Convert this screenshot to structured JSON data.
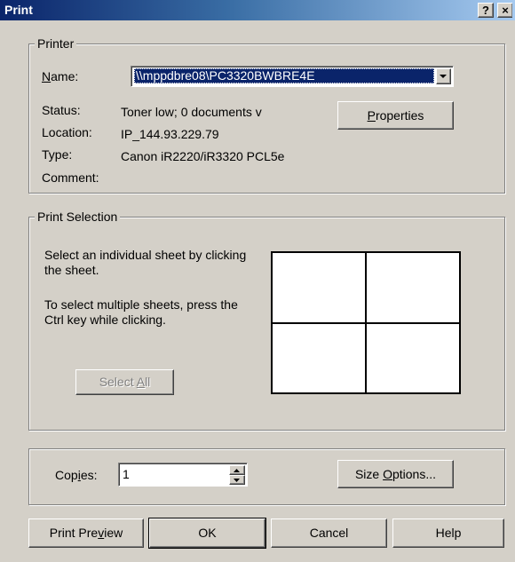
{
  "window": {
    "title": "Print",
    "help_glyph": "?",
    "close_glyph": "×"
  },
  "printer_group": {
    "label": "Printer",
    "name_label_prefix": "",
    "name_label_mnemonic": "N",
    "name_label_rest": "ame:",
    "name_value": "\\\\mppdbre08\\PC3320BWBRE4E",
    "status_label": "Status:",
    "status_value": "Toner low; 0 documents v",
    "location_label": "Location:",
    "location_value": "IP_144.93.229.79",
    "type_label": "Type:",
    "type_value": "Canon iR2220/iR3320 PCL5e",
    "comment_label": "Comment:",
    "comment_value": "",
    "properties_prefix": "",
    "properties_mnemonic": "P",
    "properties_rest": "roperties",
    "dropdown_icon": "triangle-down"
  },
  "selection_group": {
    "label": "Print Selection",
    "instruction_1": "Select an individual sheet by clicking the sheet.",
    "instruction_2": "To select multiple sheets, press the Ctrl key while clicking.",
    "select_all_prefix": "Select ",
    "select_all_mnemonic": "A",
    "select_all_rest": "ll",
    "sheets": [
      "",
      "",
      "",
      ""
    ]
  },
  "copies_group": {
    "copies_prefix": "Cop",
    "copies_mnemonic": "i",
    "copies_rest": "es:",
    "copies_value": "1",
    "size_options_prefix": "Size ",
    "size_options_mnemonic": "O",
    "size_options_rest": "ptions..."
  },
  "buttons": {
    "preview_prefix": "Print Pre",
    "preview_mnemonic": "v",
    "preview_rest": "iew",
    "ok": "OK",
    "cancel": "Cancel",
    "help": "Help"
  }
}
